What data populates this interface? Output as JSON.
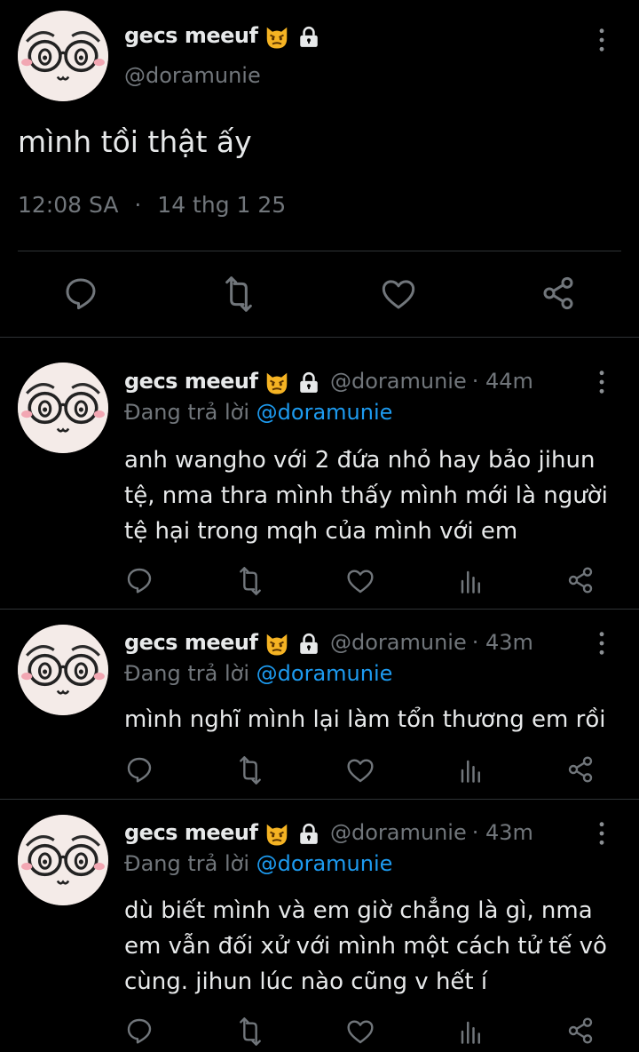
{
  "main_tweet": {
    "display_name": "gecs meeuf",
    "handle": "@doramunie",
    "text": "mình tồi thật ấy",
    "time": "12:08 SA",
    "separator": "·",
    "date": "14 thg 1 25"
  },
  "replies": [
    {
      "display_name": "gecs meeuf",
      "handle": "@doramunie",
      "age": "· 44m",
      "replying_prefix": "Đang trả lời",
      "replying_to": "@doramunie",
      "lines": [
        "anh wangho với 2 đứa nhỏ hay bảo jihun",
        "tệ, nma thra mình thấy mình mới là người",
        "tệ hại trong mqh của mình với em"
      ]
    },
    {
      "display_name": "gecs meeuf",
      "handle": "@doramunie",
      "age": "· 43m",
      "replying_prefix": "Đang trả lời",
      "replying_to": "@doramunie",
      "lines": [
        "mình nghĩ mình lại làm tổn thương em rồi"
      ]
    },
    {
      "display_name": "gecs meeuf",
      "handle": "@doramunie",
      "age": "· 43m",
      "replying_prefix": "Đang trả lời",
      "replying_to": "@doramunie",
      "lines": [
        "dù biết mình và em giờ chẳng là gì, nma",
        "em vẫn đối xử với mình một cách tử tế vô",
        "cùng. jihun lúc nào cũng v hết í"
      ]
    }
  ],
  "icons": {
    "badge_emoji": "angry-cat-emoji",
    "lock": "lock-icon",
    "more": "more-vertical-icon",
    "reply": "reply-icon",
    "retweet": "retweet-icon",
    "like": "like-icon",
    "share": "share-icon",
    "views": "views-icon"
  },
  "colors": {
    "background": "#000000",
    "text": "#e7e9ea",
    "muted": "#71767b",
    "link": "#1d9bf0",
    "divider": "#2f3336",
    "emoji": "#f5b323"
  }
}
